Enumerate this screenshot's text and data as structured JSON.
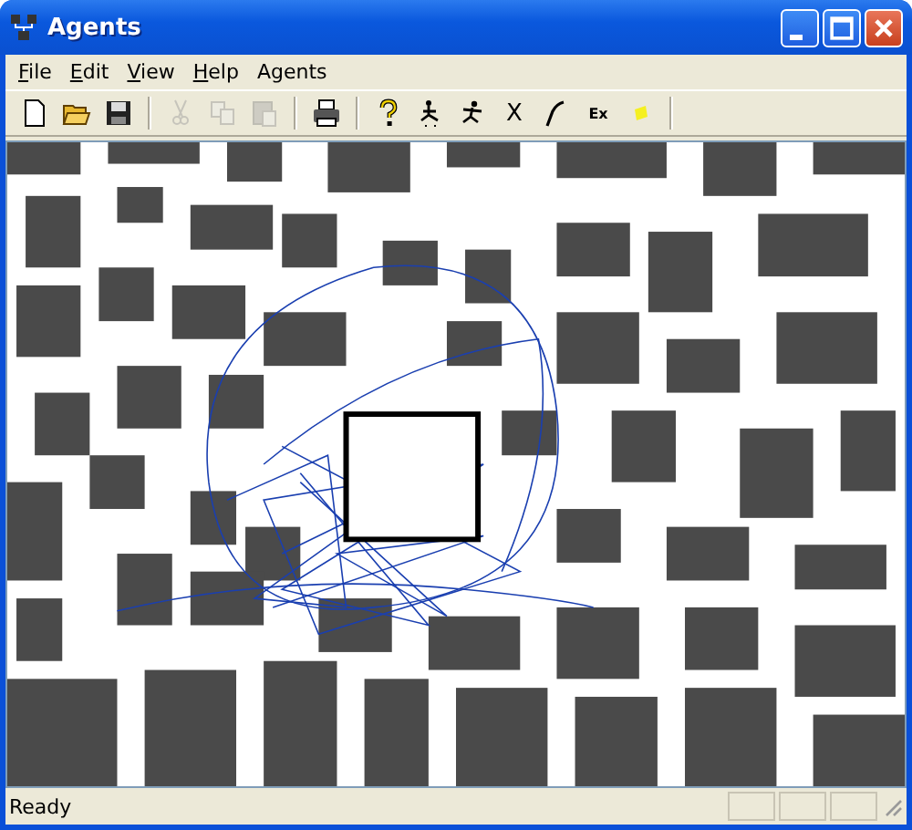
{
  "window": {
    "title": "Agents"
  },
  "menu": [
    {
      "label": "File",
      "mnemonic": true
    },
    {
      "label": "Edit",
      "mnemonic": true
    },
    {
      "label": "View",
      "mnemonic": true
    },
    {
      "label": "Help",
      "mnemonic": true
    },
    {
      "label": "Agents",
      "mnemonic": false
    }
  ],
  "toolbar": [
    {
      "kind": "new",
      "disabled": false
    },
    {
      "kind": "open",
      "disabled": false
    },
    {
      "kind": "save",
      "disabled": false
    },
    {
      "kind": "separator"
    },
    {
      "kind": "cut",
      "disabled": true
    },
    {
      "kind": "copy",
      "disabled": true
    },
    {
      "kind": "paste",
      "disabled": true
    },
    {
      "kind": "separator"
    },
    {
      "kind": "print",
      "disabled": false
    },
    {
      "kind": "separator"
    },
    {
      "kind": "help",
      "disabled": false
    },
    {
      "kind": "walker",
      "disabled": false
    },
    {
      "kind": "runner",
      "disabled": false
    },
    {
      "kind": "text",
      "label": "X",
      "disabled": false
    },
    {
      "kind": "pen",
      "disabled": false
    },
    {
      "kind": "text",
      "label": "Ex",
      "disabled": false
    },
    {
      "kind": "marker",
      "disabled": false
    }
  ],
  "status_bar": {
    "text": "Ready"
  }
}
